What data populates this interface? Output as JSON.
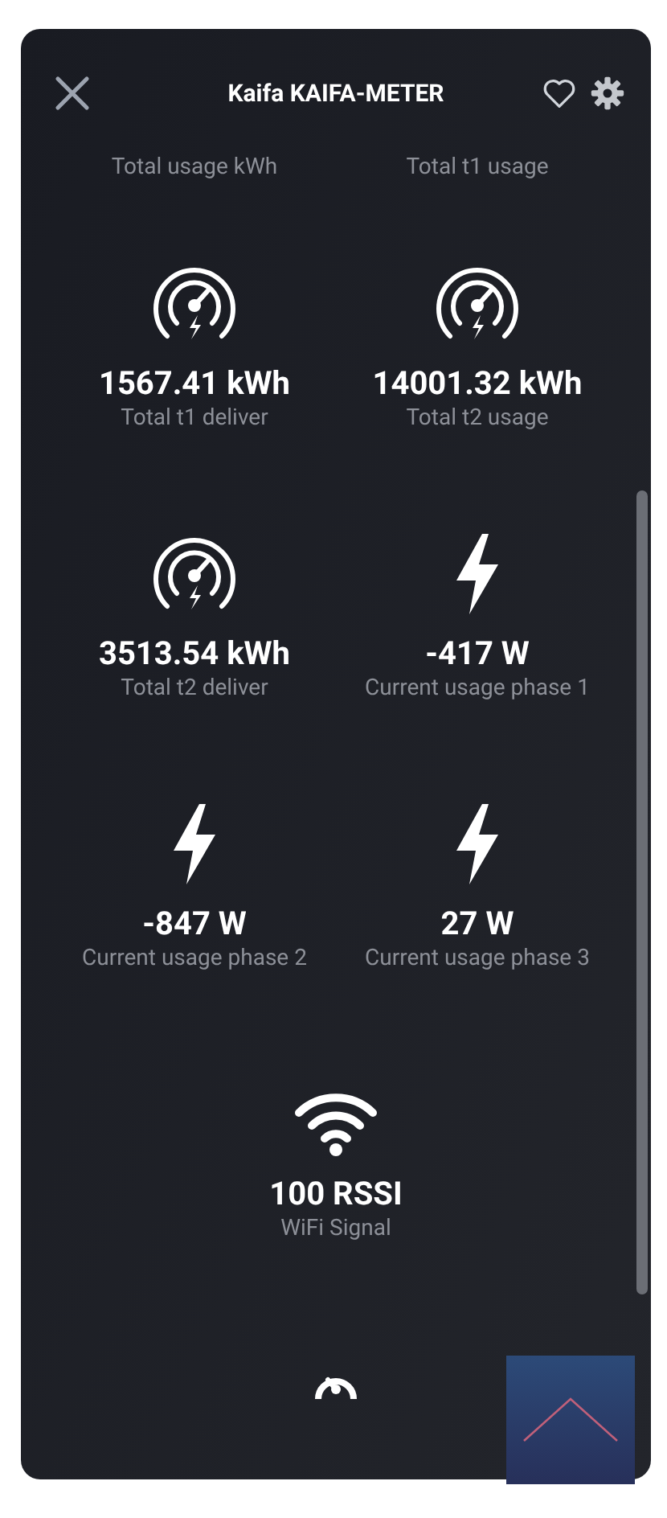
{
  "header": {
    "title": "Kaifa KAIFA-METER"
  },
  "top_labels": [
    "Total usage kWh",
    "Total t1 usage"
  ],
  "tiles": [
    {
      "kind": "gauge",
      "value": "1567.41 kWh",
      "label": "Total t1 deliver"
    },
    {
      "kind": "gauge",
      "value": "14001.32 kWh",
      "label": "Total t2 usage"
    },
    {
      "kind": "gauge",
      "value": "3513.54 kWh",
      "label": "Total t2 deliver"
    },
    {
      "kind": "bolt",
      "value": "-417 W",
      "label": "Current usage phase 1"
    },
    {
      "kind": "bolt",
      "value": "-847 W",
      "label": "Current usage phase 2"
    },
    {
      "kind": "bolt",
      "value": "27 W",
      "label": "Current usage phase 3"
    },
    {
      "kind": "wifi",
      "value": "100 RSSI",
      "label": "WiFi Signal"
    }
  ]
}
